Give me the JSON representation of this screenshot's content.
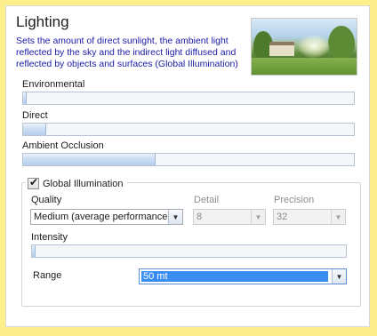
{
  "header": {
    "title": "Lighting",
    "description": "Sets the amount of direct sunlight, the ambient light reflected by the sky and the indirect light diffused and reflected by objects and surfaces (Global Illumination)"
  },
  "sliders": {
    "environmental": {
      "label": "Environmental",
      "value": 0.01
    },
    "direct": {
      "label": "Direct",
      "value": 0.07
    },
    "ambient_occlusion": {
      "label": "Ambient Occlusion",
      "value": 0.4
    }
  },
  "global_illumination": {
    "label": "Global Illumination",
    "checked": true,
    "quality": {
      "label": "Quality",
      "value": "Medium (average performance)"
    },
    "detail": {
      "label": "Detail",
      "value": "8",
      "enabled": false
    },
    "precision": {
      "label": "Precision",
      "value": "32",
      "enabled": false
    },
    "intensity": {
      "label": "Intensity",
      "value": 0.01
    },
    "range": {
      "label": "Range",
      "value": "50 mt"
    }
  },
  "colors": {
    "background": "#fdef8c",
    "description_text": "#1a1aa6",
    "slider_fill": "#c9dcf2",
    "selection": "#3a8ef2"
  },
  "icons": {
    "checkbox_tick": "✔",
    "dropdown_arrow": "▼"
  }
}
